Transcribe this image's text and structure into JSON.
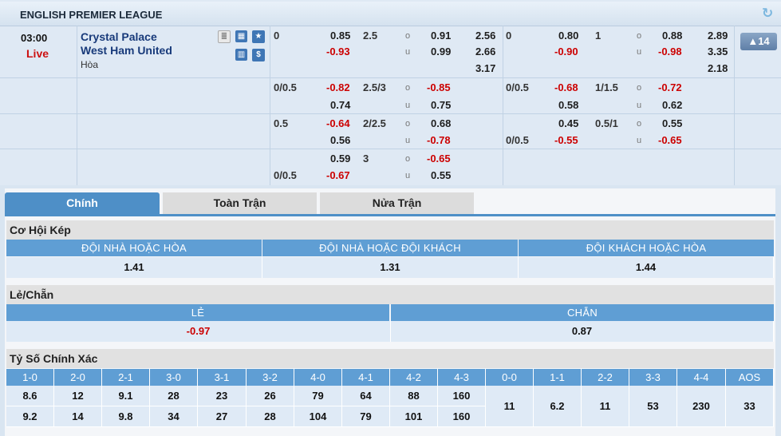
{
  "league": {
    "title": "ENGLISH PREMIER LEAGUE",
    "refresh_icon": "refresh-icon"
  },
  "match": {
    "time": "03:00",
    "status": "Live",
    "home": "Crystal Palace",
    "away": "West Ham United",
    "draw_label": "Hòa",
    "more_count": "▲14",
    "icons": [
      "lineup-icon",
      "field-icon",
      "star-icon",
      "stats-icon",
      "dollar-icon"
    ]
  },
  "rows": [
    {
      "ft_hdp": "0",
      "ft_hdp_h": "0.85",
      "ft_hdp_a": "-0.93",
      "ft_ou": "2.5",
      "ft_ou_o": "0.91",
      "ft_ou_u": "0.99",
      "ft_1x2": [
        "2.56",
        "2.66",
        "3.17"
      ],
      "h1_hdp": "0",
      "h1_hdp_h": "0.80",
      "h1_hdp_a": "-0.90",
      "h1_ou": "1",
      "h1_ou_o": "0.88",
      "h1_ou_u": "-0.98",
      "h1_1x2": [
        "2.89",
        "3.35",
        "2.18"
      ]
    },
    {
      "ft_hdp": "0/0.5",
      "ft_hdp_h": "-0.82",
      "ft_hdp_a": "0.74",
      "ft_ou": "2.5/3",
      "ft_ou_o": "-0.85",
      "ft_ou_u": "0.75",
      "h1_hdp": "0/0.5",
      "h1_hdp_h": "-0.68",
      "h1_hdp_a": "0.58",
      "h1_ou": "1/1.5",
      "h1_ou_o": "-0.72",
      "h1_ou_u": "0.62"
    },
    {
      "ft_hdp": "0.5",
      "ft_hdp_h": "-0.64",
      "ft_hdp_a": "0.56",
      "ft_ou": "2/2.5",
      "ft_ou_o": "0.68",
      "ft_ou_u": "-0.78",
      "h1_hdp": "0/0.5",
      "h1_hdp_h": "0.45",
      "h1_hdp_a": "-0.55",
      "h1_ou": "0.5/1",
      "h1_ou_o": "0.55",
      "h1_ou_u": "-0.65"
    },
    {
      "ft_hdp": "0/0.5",
      "ft_hdp_h": "0.59",
      "ft_hdp_a": "-0.67",
      "ft_ou": "3",
      "ft_ou_o": "-0.65",
      "ft_ou_u": "0.55"
    }
  ],
  "ou_labels": {
    "over": "o",
    "under": "u"
  },
  "tabs": [
    "Chính",
    "Toàn Trận",
    "Nửa Trận"
  ],
  "double_chance": {
    "title": "Cơ Hội Kép",
    "headers": [
      "ĐỘI NHÀ HOẶC HÒA",
      "ĐỘI NHÀ HOẶC ĐỘI KHÁCH",
      "ĐỘI KHÁCH HOẶC HÒA"
    ],
    "values": [
      "1.41",
      "1.31",
      "1.44"
    ]
  },
  "odd_even": {
    "title": "Lẻ/Chẵn",
    "headers": [
      "LẺ",
      "CHẴN"
    ],
    "values": [
      "-0.97",
      "0.87"
    ]
  },
  "correct_score": {
    "title": "Tỷ Số Chính Xác",
    "headers": [
      "1-0",
      "2-0",
      "2-1",
      "3-0",
      "3-1",
      "3-2",
      "4-0",
      "4-1",
      "4-2",
      "4-3",
      "0-0",
      "1-1",
      "2-2",
      "3-3",
      "4-4",
      "AOS"
    ],
    "home_row": [
      "8.6",
      "12",
      "9.1",
      "28",
      "23",
      "26",
      "79",
      "64",
      "88",
      "160"
    ],
    "away_row": [
      "9.2",
      "14",
      "9.8",
      "34",
      "27",
      "28",
      "104",
      "79",
      "101",
      "160"
    ],
    "draw_row": [
      "11",
      "6.2",
      "11",
      "53",
      "230",
      "33"
    ]
  }
}
